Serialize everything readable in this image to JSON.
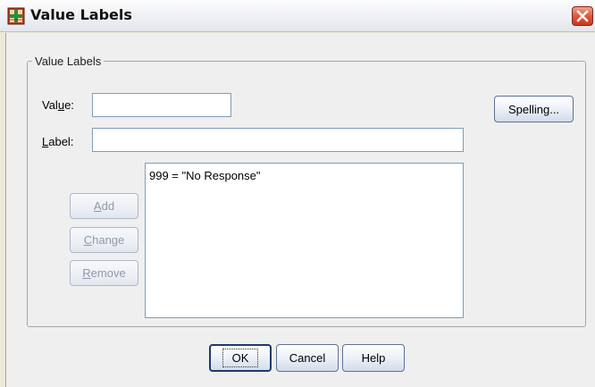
{
  "window": {
    "title": "Value Labels",
    "close_icon": "close-icon"
  },
  "group": {
    "legend": "Value Labels"
  },
  "fields": {
    "value_label_pre": "Val",
    "value_label_key": "u",
    "value_label_post": "e:",
    "value_input": "",
    "label_label_key": "L",
    "label_label_post": "abel:",
    "label_input": ""
  },
  "list": {
    "items": [
      "999 = \"No Response\""
    ]
  },
  "buttons": {
    "spelling": "Spelling...",
    "add_key": "A",
    "add_post": "dd",
    "change_key": "C",
    "change_post": "hange",
    "remove_key": "R",
    "remove_post": "emove",
    "ok": "OK",
    "cancel": "Cancel",
    "help": "Help"
  },
  "colors": {
    "app_icon": "#2e8b3a",
    "close_button": "#d94a2c"
  }
}
